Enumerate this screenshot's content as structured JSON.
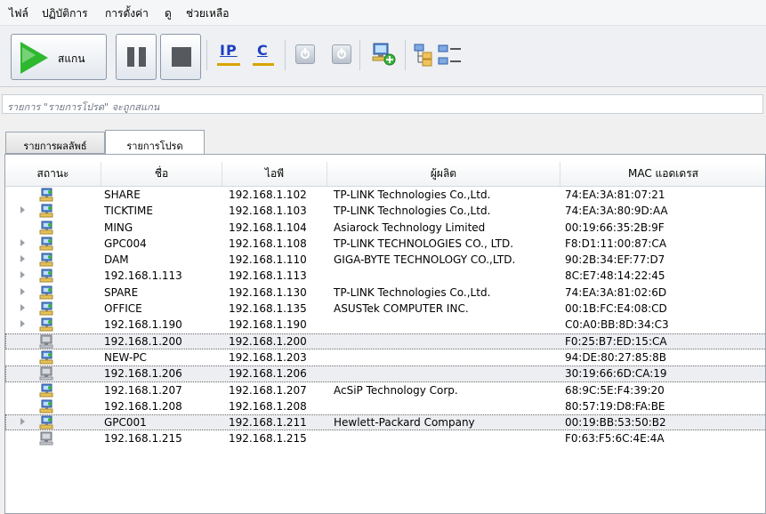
{
  "menu": [
    "ไฟล์",
    "ปฏิบัติการ",
    "การตั้งค่า",
    "ดู",
    "ช่วยเหลือ"
  ],
  "toolbar": {
    "scan_label": "สแกน",
    "ip_label": "IP",
    "c_label": "C"
  },
  "status_message": "รายการ \"รายการโปรด\" จะถูกสแกน",
  "tabs": [
    {
      "label": "รายการผลลัพธ์",
      "active": false
    },
    {
      "label": "รายการโปรด",
      "active": true
    }
  ],
  "table": {
    "columns": [
      "สถานะ",
      "ชื่อ",
      "ไอพี",
      "ผู้ผลิต",
      "MAC แอดเดรส"
    ],
    "rows": [
      {
        "expand": false,
        "icon": "network-device-icon",
        "name": "SHARE",
        "ip": "192.168.1.102",
        "vendor": "TP-LINK Technologies Co.,Ltd.",
        "mac": "74:EA:3A:81:07:21"
      },
      {
        "expand": true,
        "icon": "network-device-icon",
        "name": "TICKTIME",
        "ip": "192.168.1.103",
        "vendor": "TP-LINK Technologies Co.,Ltd.",
        "mac": "74:EA:3A:80:9D:AA"
      },
      {
        "expand": false,
        "icon": "network-device-icon",
        "name": "MING",
        "ip": "192.168.1.104",
        "vendor": "Asiarock Technology Limited",
        "mac": "00:19:66:35:2B:9F"
      },
      {
        "expand": true,
        "icon": "network-device-icon",
        "name": "GPC004",
        "ip": "192.168.1.108",
        "vendor": "TP-LINK TECHNOLOGIES CO., LTD.",
        "mac": "F8:D1:11:00:87:CA"
      },
      {
        "expand": true,
        "icon": "network-device-icon",
        "name": "DAM",
        "ip": "192.168.1.110",
        "vendor": "GIGA-BYTE TECHNOLOGY CO.,LTD.",
        "mac": "90:2B:34:EF:77:D7"
      },
      {
        "expand": true,
        "icon": "network-device-icon",
        "name": "192.168.1.113",
        "ip": "192.168.1.113",
        "vendor": "",
        "mac": "8C:E7:48:14:22:45"
      },
      {
        "expand": true,
        "icon": "network-device-icon",
        "name": "SPARE",
        "ip": "192.168.1.130",
        "vendor": "TP-LINK Technologies Co.,Ltd.",
        "mac": "74:EA:3A:81:02:6D"
      },
      {
        "expand": true,
        "icon": "network-device-icon",
        "name": "OFFICE",
        "ip": "192.168.1.135",
        "vendor": "ASUSTek COMPUTER INC.",
        "mac": "00:1B:FC:E4:08:CD"
      },
      {
        "expand": true,
        "icon": "network-device-icon",
        "name": "192.168.1.190",
        "ip": "192.168.1.190",
        "vendor": "",
        "mac": "C0:A0:BB:8D:34:C3"
      },
      {
        "expand": false,
        "icon": "offline-device-icon",
        "name": "192.168.1.200",
        "ip": "192.168.1.200",
        "vendor": "",
        "mac": "F0:25:B7:ED:15:CA",
        "selected": true
      },
      {
        "expand": false,
        "icon": "network-device-icon",
        "name": "NEW-PC",
        "ip": "192.168.1.203",
        "vendor": "",
        "mac": "94:DE:80:27:85:8B"
      },
      {
        "expand": false,
        "icon": "offline-device-icon",
        "name": "192.168.1.206",
        "ip": "192.168.1.206",
        "vendor": "",
        "mac": "30:19:66:6D:CA:19",
        "selected": true
      },
      {
        "expand": false,
        "icon": "network-device-icon",
        "name": "192.168.1.207",
        "ip": "192.168.1.207",
        "vendor": "AcSiP Technology Corp.",
        "mac": "68:9C:5E:F4:39:20"
      },
      {
        "expand": false,
        "icon": "network-device-icon",
        "name": "192.168.1.208",
        "ip": "192.168.1.208",
        "vendor": "",
        "mac": "80:57:19:D8:FA:BE"
      },
      {
        "expand": true,
        "icon": "network-device-icon",
        "name": "GPC001",
        "ip": "192.168.1.211",
        "vendor": "Hewlett-Packard Company",
        "mac": "00:19:BB:53:50:B2",
        "selected": true
      },
      {
        "expand": false,
        "icon": "offline-device-icon",
        "name": "192.168.1.215",
        "ip": "192.168.1.215",
        "vendor": "",
        "mac": "F0:63:F5:6C:4E:4A"
      }
    ]
  },
  "colors": {
    "accent": "#2db82f",
    "ip_blue": "#1d3fbf",
    "underline_gold": "#d8a400"
  }
}
